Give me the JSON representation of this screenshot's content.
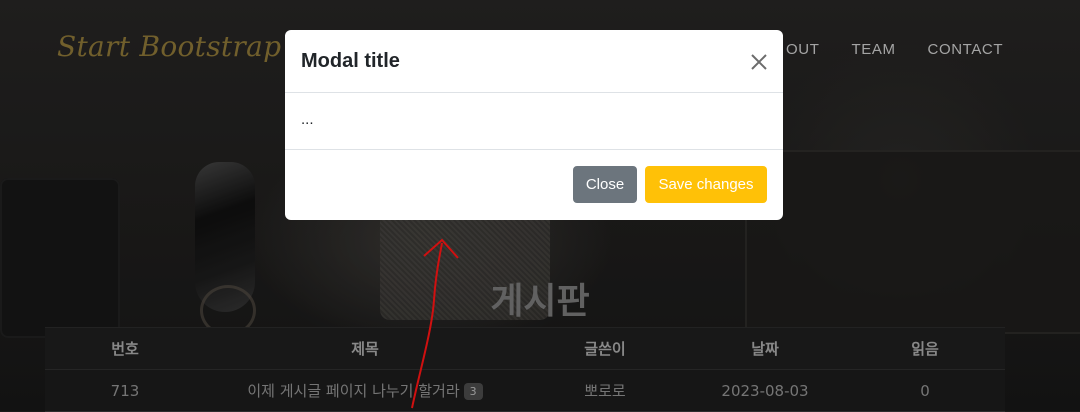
{
  "navbar": {
    "brand": "Start Bootstrap",
    "links": [
      "OUT",
      "TEAM",
      "CONTACT"
    ]
  },
  "page": {
    "heading": "게시판"
  },
  "board": {
    "columns": [
      "번호",
      "제목",
      "글쓴이",
      "날짜",
      "읽음"
    ],
    "rows": [
      {
        "no": "713",
        "title": "이제 게시글 페이지 나누기 할거라",
        "comments": "3",
        "writer": "뽀로로",
        "date": "2023-08-03",
        "views": "0"
      }
    ]
  },
  "modal": {
    "title": "Modal title",
    "body": "...",
    "close_label": "Close",
    "save_label": "Save changes"
  },
  "colors": {
    "brand": "#8a7436",
    "save_button": "#ffc107",
    "close_button": "#6c757d",
    "annotation_arrow": "#d01010"
  }
}
